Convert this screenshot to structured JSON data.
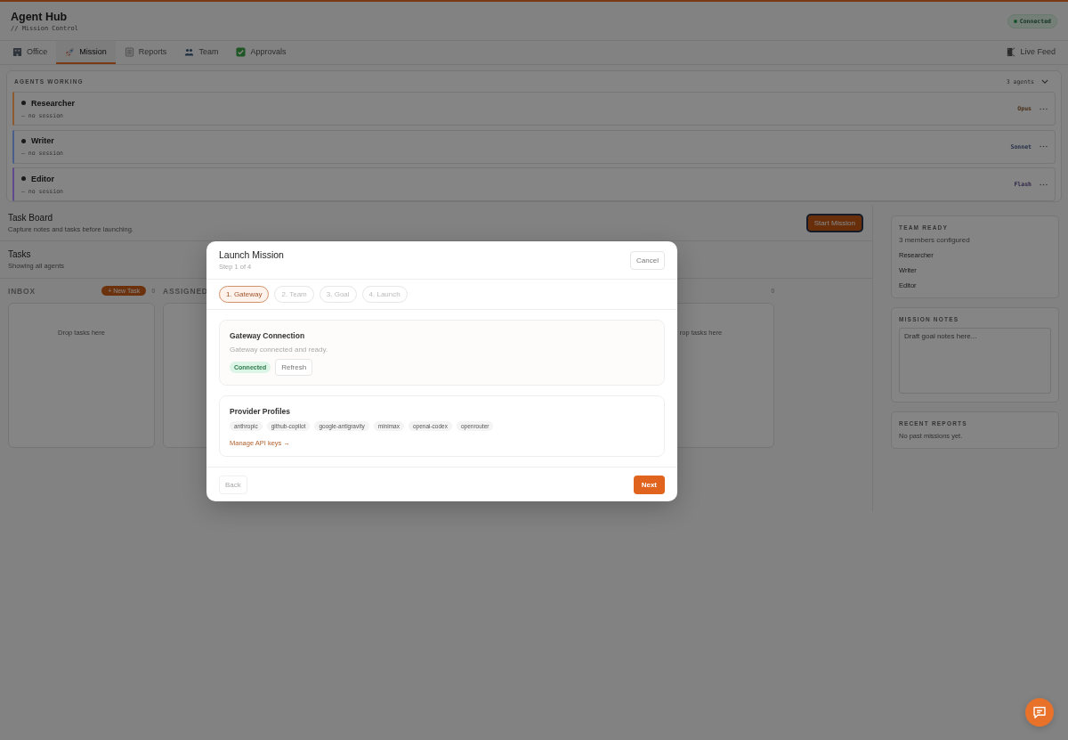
{
  "header": {
    "title": "Agent Hub",
    "subtitle": "// Mission Control",
    "status": "Connected"
  },
  "tabs": [
    {
      "label": "Office",
      "selected": false
    },
    {
      "label": "Mission",
      "selected": true
    },
    {
      "label": "Reports",
      "selected": false
    },
    {
      "label": "Team",
      "selected": false
    },
    {
      "label": "Approvals",
      "selected": false
    }
  ],
  "live_feed": "Live Feed",
  "agents_panel": {
    "title": "AGENTS WORKING",
    "count": "3 agents",
    "expanded": true,
    "agents": [
      {
        "name": "Researcher",
        "session": "— no session",
        "model": "Opus",
        "color": "#8c5a2e"
      },
      {
        "name": "Writer",
        "session": "— no session",
        "model": "Sonnet",
        "color": "#4a5e8c"
      },
      {
        "name": "Editor",
        "session": "— no session",
        "model": "Flash",
        "color": "#5e4a8c"
      }
    ]
  },
  "task_board": {
    "title": "Task Board",
    "subtitle": "Capture notes and tasks before launching.",
    "start_button": "Start Mission"
  },
  "tasks": {
    "title": "Tasks",
    "subtitle": "Showing all agents"
  },
  "columns": [
    {
      "title": "INBOX",
      "new_task": "+ New Task",
      "count": "0",
      "placeholder": "Drop tasks here"
    },
    {
      "title": "ASSIGNED"
    },
    {
      "count": "0",
      "placeholder": "rop tasks here"
    }
  ],
  "sidebar": {
    "team_ready": {
      "title": "TEAM READY",
      "subtitle": "3 members configured",
      "members": [
        "Researcher",
        "Writer",
        "Editor"
      ]
    },
    "mission_notes": {
      "title": "MISSION NOTES",
      "placeholder": "Draft goal notes here..."
    },
    "recent_reports": {
      "title": "RECENT REPORTS",
      "empty": "No past missions yet."
    }
  },
  "modal": {
    "title": "Launch Mission",
    "step": "Step 1 of 4",
    "cancel": "Cancel",
    "steps": [
      {
        "label": "1. Gateway",
        "selected": true
      },
      {
        "label": "2. Team",
        "selected": false
      },
      {
        "label": "3. Goal",
        "selected": false
      },
      {
        "label": "4. Launch",
        "selected": false
      }
    ],
    "gateway": {
      "title": "Gateway Connection",
      "description": "Gateway connected and ready.",
      "status": "Connected",
      "refresh": "Refresh"
    },
    "providers": {
      "title": "Provider Profiles",
      "profiles": [
        "anthropic",
        "github-copilot",
        "google-antigravity",
        "minimax",
        "openai-codex",
        "openrouter"
      ],
      "link": "Manage API keys →"
    },
    "back": {
      "label": "Back",
      "disabled": true
    },
    "next": "Next"
  }
}
